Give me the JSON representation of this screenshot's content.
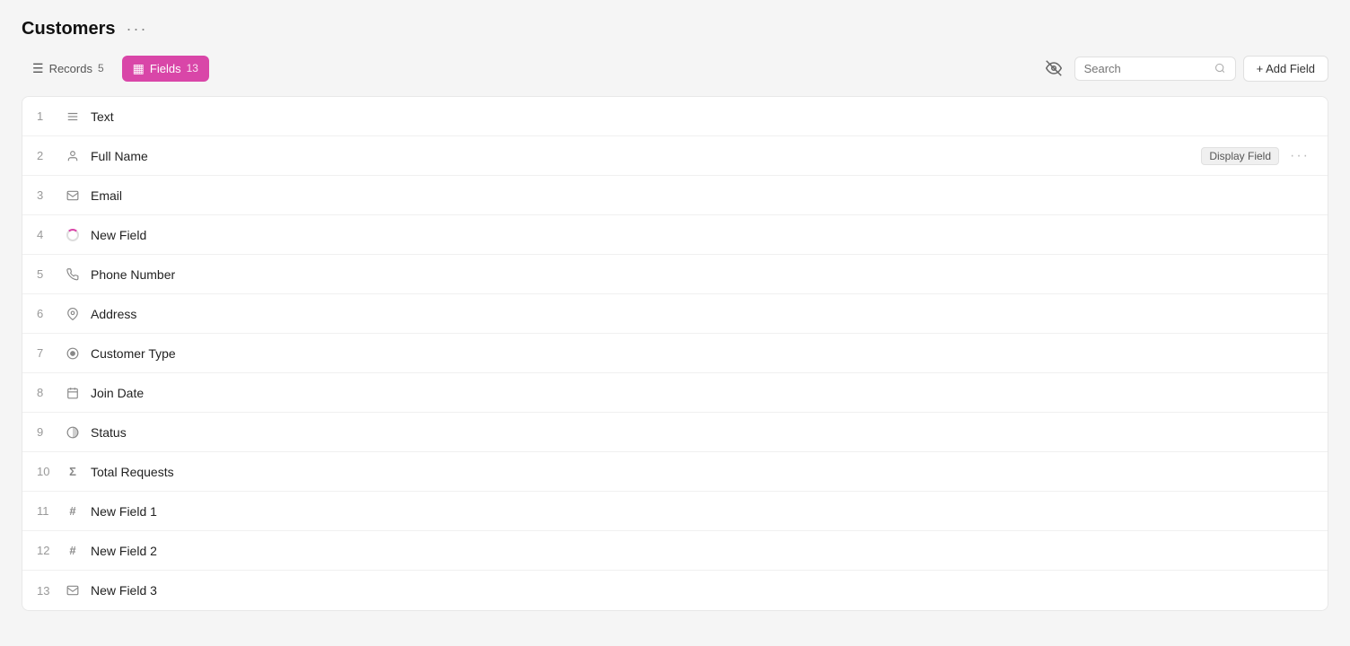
{
  "page": {
    "title": "Customers",
    "more_label": "···"
  },
  "toolbar": {
    "records_label": "Records",
    "records_count": "5",
    "fields_label": "Fields",
    "fields_count": "13",
    "search_placeholder": "Search",
    "add_field_label": "+ Add Field"
  },
  "fields": [
    {
      "number": "1",
      "icon": "text-icon",
      "icon_char": "≡",
      "name": "Text",
      "display_field": false
    },
    {
      "number": "2",
      "icon": "person-icon",
      "icon_char": "👤",
      "name": "Full Name",
      "display_field": true
    },
    {
      "number": "3",
      "icon": "email-icon",
      "icon_char": "✉",
      "name": "Email",
      "display_field": false
    },
    {
      "number": "4",
      "icon": "loading-icon",
      "icon_char": "",
      "name": "New Field",
      "display_field": false,
      "loading": true
    },
    {
      "number": "5",
      "icon": "phone-icon",
      "icon_char": "📞",
      "name": "Phone Number",
      "display_field": false
    },
    {
      "number": "6",
      "icon": "location-icon",
      "icon_char": "📍",
      "name": "Address",
      "display_field": false
    },
    {
      "number": "7",
      "icon": "select-icon",
      "icon_char": "◉",
      "name": "Customer Type",
      "display_field": false
    },
    {
      "number": "8",
      "icon": "date-icon",
      "icon_char": "📅",
      "name": "Join Date",
      "display_field": false
    },
    {
      "number": "9",
      "icon": "status-icon",
      "icon_char": "◕",
      "name": "Status",
      "display_field": false
    },
    {
      "number": "10",
      "icon": "formula-icon",
      "icon_char": "Σ",
      "name": "Total Requests",
      "display_field": false
    },
    {
      "number": "11",
      "icon": "number-icon",
      "icon_char": "#",
      "name": "New Field 1",
      "display_field": false
    },
    {
      "number": "12",
      "icon": "number-icon",
      "icon_char": "#",
      "name": "New Field 2",
      "display_field": false
    },
    {
      "number": "13",
      "icon": "email2-icon",
      "icon_char": "✉",
      "name": "New Field 3",
      "display_field": false
    }
  ],
  "badges": {
    "display_field_label": "Display Field"
  },
  "colors": {
    "active_tab": "#d946a8"
  }
}
